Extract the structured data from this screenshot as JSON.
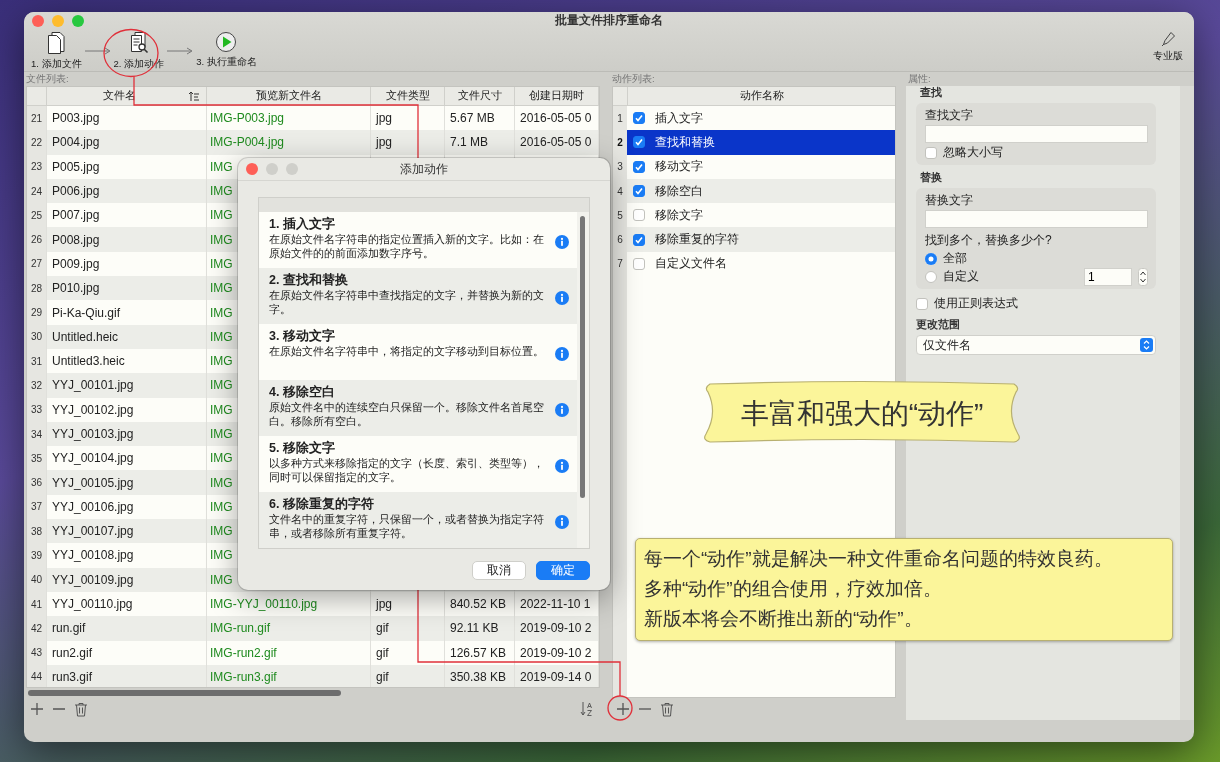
{
  "window": {
    "title": "批量文件排序重命名"
  },
  "toolbar": {
    "steps": [
      {
        "kind": "files",
        "label": "1. 添加文件"
      },
      {
        "kind": "actions",
        "label": "2. 添加动作"
      },
      {
        "kind": "run",
        "label": "3. 执行重命名"
      }
    ],
    "pro_label": "专业版"
  },
  "file_list": {
    "label": "文件列表:",
    "columns": [
      "文件名",
      "预览新文件名",
      "文件类型",
      "文件尺寸",
      "创建日期时"
    ],
    "rows": [
      {
        "number": "21",
        "name": "P003.jpg",
        "preview": "IMG-P003.jpg",
        "type": "jpg",
        "size": "5.67 MB",
        "created": "2016-05-05 0"
      },
      {
        "number": "22",
        "name": "P004.jpg",
        "preview": "IMG-P004.jpg",
        "type": "jpg",
        "size": "7.1 MB",
        "created": "2016-05-05 0"
      },
      {
        "number": "23",
        "name": "P005.jpg",
        "preview": "IMG"
      },
      {
        "number": "24",
        "name": "P006.jpg",
        "preview": "IMG"
      },
      {
        "number": "25",
        "name": "P007.jpg",
        "preview": "IMG"
      },
      {
        "number": "26",
        "name": "P008.jpg",
        "preview": "IMG"
      },
      {
        "number": "27",
        "name": "P009.jpg",
        "preview": "IMG"
      },
      {
        "number": "28",
        "name": "P010.jpg",
        "preview": "IMG"
      },
      {
        "number": "29",
        "name": "Pi-Ka-Qiu.gif",
        "preview": "IMG"
      },
      {
        "number": "30",
        "name": "Untitled.heic",
        "preview": "IMG"
      },
      {
        "number": "31",
        "name": "Untitled3.heic",
        "preview": "IMG"
      },
      {
        "number": "32",
        "name": "YYJ_00101.jpg",
        "preview": "IMG"
      },
      {
        "number": "33",
        "name": "YYJ_00102.jpg",
        "preview": "IMG"
      },
      {
        "number": "34",
        "name": "YYJ_00103.jpg",
        "preview": "IMG"
      },
      {
        "number": "35",
        "name": "YYJ_00104.jpg",
        "preview": "IMG"
      },
      {
        "number": "36",
        "name": "YYJ_00105.jpg",
        "preview": "IMG"
      },
      {
        "number": "37",
        "name": "YYJ_00106.jpg",
        "preview": "IMG"
      },
      {
        "number": "38",
        "name": "YYJ_00107.jpg",
        "preview": "IMG"
      },
      {
        "number": "39",
        "name": "YYJ_00108.jpg",
        "preview": "IMG"
      },
      {
        "number": "40",
        "name": "YYJ_00109.jpg",
        "preview": "IMG"
      },
      {
        "number": "41",
        "name": "YYJ_00110.jpg",
        "preview": "IMG-YYJ_00110.jpg",
        "type": "jpg",
        "size": "840.52 KB",
        "created": "2022-11-10 1"
      },
      {
        "number": "42",
        "name": "run.gif",
        "preview": "IMG-run.gif",
        "type": "gif",
        "size": "92.11 KB",
        "created": "2019-09-10 2"
      },
      {
        "number": "43",
        "name": "run2.gif",
        "preview": "IMG-run2.gif",
        "type": "gif",
        "size": "126.57 KB",
        "created": "2019-09-10 2"
      },
      {
        "number": "44",
        "name": "run3.gif",
        "preview": "IMG-run3.gif",
        "type": "gif",
        "size": "350.38 KB",
        "created": "2019-09-14 0"
      }
    ]
  },
  "action_list": {
    "label": "动作列表:",
    "column": "动作名称",
    "rows": [
      {
        "number": "1",
        "name": "插入文字",
        "checked": true,
        "selected": false
      },
      {
        "number": "2",
        "name": "查找和替换",
        "checked": true,
        "selected": true
      },
      {
        "number": "3",
        "name": "移动文字",
        "checked": true,
        "selected": false
      },
      {
        "number": "4",
        "name": "移除空白",
        "checked": true,
        "selected": false
      },
      {
        "number": "5",
        "name": "移除文字",
        "checked": false,
        "selected": false
      },
      {
        "number": "6",
        "name": "移除重复的字符",
        "checked": true,
        "selected": false
      },
      {
        "number": "7",
        "name": "自定义文件名",
        "checked": false,
        "selected": false
      }
    ]
  },
  "properties": {
    "label": "属性:",
    "find": {
      "heading": "查找",
      "field_label": "查找文字",
      "ignore_case": {
        "label": "忽略大小写",
        "checked": false
      }
    },
    "replace": {
      "heading": "替换",
      "field_label": "替换文字",
      "question": "找到多个，替换多少个?",
      "options": [
        {
          "label": "全部",
          "selected": true
        },
        {
          "label": "自定义",
          "selected": false
        }
      ],
      "count": "1"
    },
    "regex": {
      "label": "使用正则表达式",
      "checked": false
    },
    "scope": {
      "label": "更改范围",
      "value": "仅文件名"
    }
  },
  "dialog": {
    "title": "添加动作",
    "items": [
      {
        "title": "1. 插入文字",
        "description": "在原始文件名字符串的指定位置插入新的文字。比如：在原始文件的的前面添加数字序号。"
      },
      {
        "title": "2. 查找和替换",
        "description": "在原始文件名字符串中查找指定的文字，并替换为新的文字。"
      },
      {
        "title": "3. 移动文字",
        "description": "在原始文件名字符串中，将指定的文字移动到目标位置。"
      },
      {
        "title": "4. 移除空白",
        "description": "原始文件名中的连续空白只保留一个。移除文件名首尾空白。移除所有空白。"
      },
      {
        "title": "5. 移除文字",
        "description": "以多种方式来移除指定的文字（长度、索引、类型等），同时可以保留指定的文字。"
      },
      {
        "title": "6. 移除重复的字符",
        "description": "文件名中的重复字符，只保留一个，或者替换为指定字符串，或者移除所有重复字符。"
      }
    ],
    "buttons": [
      {
        "label": "取消",
        "default": false
      },
      {
        "label": "确定",
        "default": true
      }
    ]
  },
  "banner": {
    "text": "丰富和强大的“动作”"
  },
  "note": {
    "lines": [
      "每一个“动作”就是解决一种文件重命名问题的特效良药。",
      "多种“动作”的组合使用，疗效加倍。",
      "新版本将会不断推出新的“动作”。"
    ]
  }
}
